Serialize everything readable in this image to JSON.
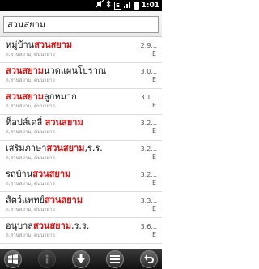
{
  "status_bar": {
    "time": "1:01",
    "icons": [
      "mute-icon",
      "bluetooth-icon",
      "network-e-icon",
      "signal-icon",
      "battery-icon"
    ],
    "network_label": "E"
  },
  "search": {
    "value": "สวนสยาม"
  },
  "results": [
    {
      "name_prefix": "หมู่บ้าน",
      "name_highlight": "สวนสยาม",
      "name_suffix": "",
      "address": "ถ.สวนสยาม, คันนายาว",
      "distance": "2.9...",
      "direction": "E"
    },
    {
      "name_prefix": "",
      "name_highlight": "สวนสยาม",
      "name_suffix": "นวดแผนโบราณ",
      "address": "ถ.สวนสยาม, คันนายาว",
      "distance": "3.0...",
      "direction": "E"
    },
    {
      "name_prefix": "",
      "name_highlight": "สวนสยาม",
      "name_suffix": "ลูกหมาก",
      "address": "ถ.สวนสยาม, คันนายาว",
      "distance": "3.1...",
      "direction": "E"
    },
    {
      "name_prefix": "ท็อปส์เดลี่ ",
      "name_highlight": "สวนสยาม",
      "name_suffix": "",
      "address": "ถ.สวนสยาม, คันนายาว",
      "distance": "3.2...",
      "direction": "E"
    },
    {
      "name_prefix": "เสริมภาษา",
      "name_highlight": "สวนสยาม",
      "name_suffix": ",ร.ร.",
      "address": "ถ.สวนสยาม, คันนายาว",
      "distance": "3.2...",
      "direction": "E"
    },
    {
      "name_prefix": "รถบ้าน",
      "name_highlight": "สวนสยาม",
      "name_suffix": "",
      "address": "ถ.สวนสยาม, คันนายาว",
      "distance": "3.2...",
      "direction": "E"
    },
    {
      "name_prefix": "สัตว์แพทย์",
      "name_highlight": "สวนสยาม",
      "name_suffix": "",
      "address": "ถ.สวนสยาม, คันนายาว",
      "distance": "3.3...",
      "direction": "E"
    },
    {
      "name_prefix": "อนุบาล",
      "name_highlight": "สวนสยาม",
      "name_suffix": ",ร.ร.",
      "address": "ถ.สวนสยาม, คันนายาว",
      "distance": "3.6...",
      "direction": "E"
    }
  ],
  "toolbar": {
    "buttons": [
      "windows-icon",
      "info-icon",
      "download-icon",
      "menu-icon",
      "back-icon"
    ]
  },
  "colors": {
    "highlight": "#e01010",
    "status_bar": "#000000"
  }
}
